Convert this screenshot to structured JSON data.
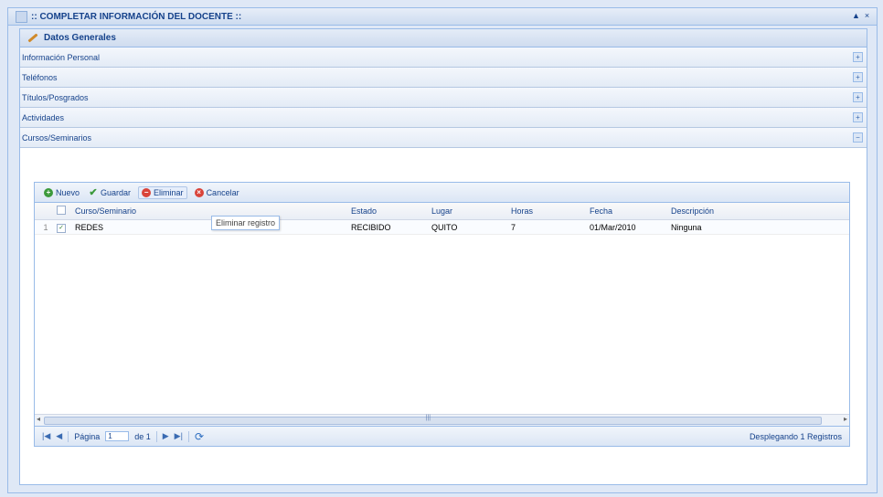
{
  "window": {
    "title": ":: COMPLETAR INFORMACIÓN DEL DOCENTE ::",
    "btn_restore": "▲",
    "btn_close": "×"
  },
  "panel": {
    "title": "Datos Generales"
  },
  "sections": [
    {
      "label": "Información Personal",
      "toggle": "+"
    },
    {
      "label": "Teléfonos",
      "toggle": "+"
    },
    {
      "label": "Títulos/Posgrados",
      "toggle": "+"
    },
    {
      "label": "Actividades",
      "toggle": "+"
    },
    {
      "label": "Cursos/Seminarios",
      "toggle": "−"
    }
  ],
  "toolbar": {
    "nuevo": "Nuevo",
    "guardar": "Guardar",
    "eliminar": "Eliminar",
    "cancelar": "Cancelar",
    "tooltip": "Eliminar registro"
  },
  "grid": {
    "headers": [
      "Curso/Seminario",
      "Estado",
      "Lugar",
      "Horas",
      "Fecha",
      "Descripción"
    ],
    "rows": [
      {
        "num": "1",
        "checked": "✓",
        "curso": "REDES",
        "estado": "RECIBIDO",
        "lugar": "QUITO",
        "horas": "7",
        "fecha": "01/Mar/2010",
        "descripcion": "Ninguna"
      }
    ]
  },
  "pager": {
    "pagina_label": "Página",
    "page_value": "1",
    "of_label": "de 1",
    "display_text": "Desplegando 1 Registros"
  },
  "colors": {
    "accent": "#15428b",
    "border": "#99bbe8",
    "green": "#3c9a3c",
    "red": "#d9443a"
  }
}
